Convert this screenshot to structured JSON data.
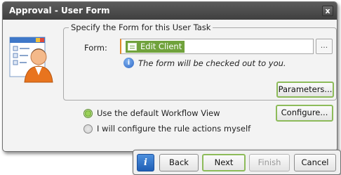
{
  "window": {
    "title": "Approval - User Form",
    "close_glyph": "x"
  },
  "group": {
    "legend": "Specify the Form for this User Task",
    "form_label": "Form:",
    "form_value": "Edit Client",
    "ellipsis_label": "...",
    "info_text": "The form will be checked out to you.",
    "parameters_label": "Parameters..."
  },
  "options": [
    {
      "label": "Use the default Workflow View",
      "selected": true
    },
    {
      "label": "I will configure the rule actions myself",
      "selected": false
    }
  ],
  "configure_label": "Configure...",
  "footer": {
    "help_glyph": "i",
    "back_label": "Back",
    "next_label": "Next",
    "finish_label": "Finish",
    "cancel_label": "Cancel"
  },
  "colors": {
    "titlebar": "#4a4a4a",
    "accent_green": "#70a23c",
    "focus_green": "#8dbb5a",
    "info_blue": "#2d66c4"
  },
  "icons": [
    "user-form-icon",
    "close-icon",
    "form-icon",
    "info-icon",
    "help-icon"
  ]
}
